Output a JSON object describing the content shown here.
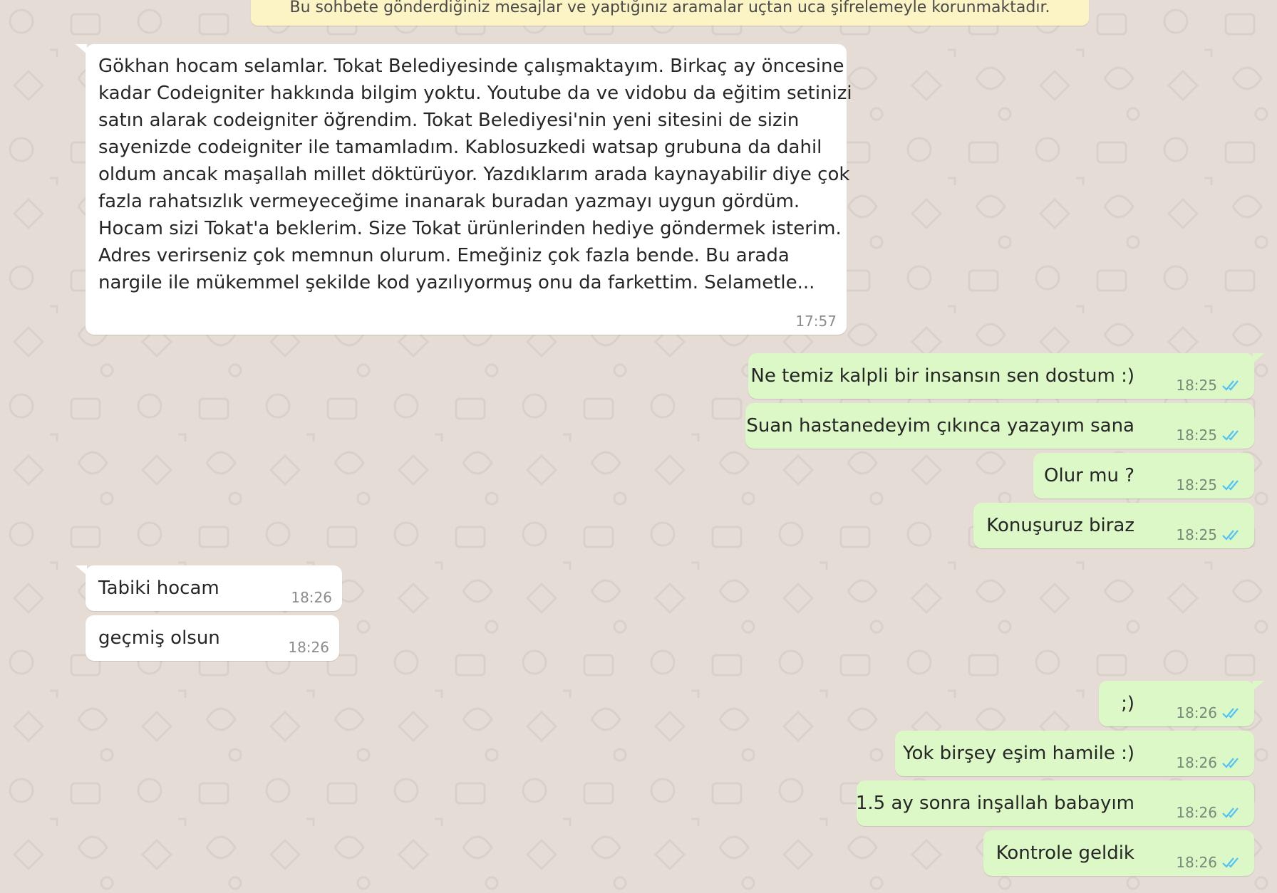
{
  "banner": "Bu sohbete gönderdiğiniz mesajlar ve yaptığınız aramalar uçtan uca şifrelemeyle korunmaktadır.",
  "colors": {
    "background": "#e5ddd5",
    "incoming_bubble": "#ffffff",
    "outgoing_bubble": "#dcf8c6",
    "banner": "#fcf4c4",
    "read_ticks": "#4fc3f7"
  },
  "messages": [
    {
      "direction": "in",
      "lines": [
        "Gökhan hocam selamlar. Tokat Belediyesinde çalışmaktayım. Birkaç ay öncesine",
        "kadar Codeigniter hakkında bilgim yoktu. Youtube da ve vidobu da eğitim setinizi",
        "satın alarak codeigniter öğrendim. Tokat Belediyesi'nin yeni sitesini de sizin",
        "sayenizde codeigniter ile tamamladım. Kablosuzkedi watsap grubuna da dahil",
        "oldum ancak maşallah millet döktürüyor. Yazdıklarım arada kaynayabilir diye çok",
        "fazla rahatsızlık vermeyeceğime inanarak buradan yazmayı uygun gördüm.",
        "Hocam sizi Tokat'a beklerim. Size Tokat ürünlerinden hediye göndermek isterim.",
        "Adres verirseniz çok memnun olurum. Emeğiniz çok fazla bende.  Bu arada",
        "nargile ile mükemmel şekilde kod yazılıyormuş onu da farkettim. Selametle..."
      ],
      "time": "17:57"
    },
    {
      "direction": "out",
      "text": "Ne temiz kalpli bir insansın sen dostum :)",
      "time": "18:25",
      "status": "read"
    },
    {
      "direction": "out",
      "text": "Suan hastanedeyim çıkınca yazayım sana",
      "time": "18:25",
      "status": "read"
    },
    {
      "direction": "out",
      "text": "Olur mu ?",
      "time": "18:25",
      "status": "read"
    },
    {
      "direction": "out",
      "text": "Konuşuruz biraz",
      "time": "18:25",
      "status": "read"
    },
    {
      "direction": "in",
      "text": "Tabiki hocam",
      "time": "18:26"
    },
    {
      "direction": "in",
      "text": "geçmiş olsun",
      "time": "18:26"
    },
    {
      "direction": "out",
      "text": ";)",
      "time": "18:26",
      "status": "read"
    },
    {
      "direction": "out",
      "text": "Yok birşey eşim hamile :)",
      "time": "18:26",
      "status": "read"
    },
    {
      "direction": "out",
      "text": "1.5 ay sonra inşallah babayım",
      "time": "18:26",
      "status": "read"
    },
    {
      "direction": "out",
      "text": "Kontrole geldik",
      "time": "18:26",
      "status": "read"
    }
  ]
}
